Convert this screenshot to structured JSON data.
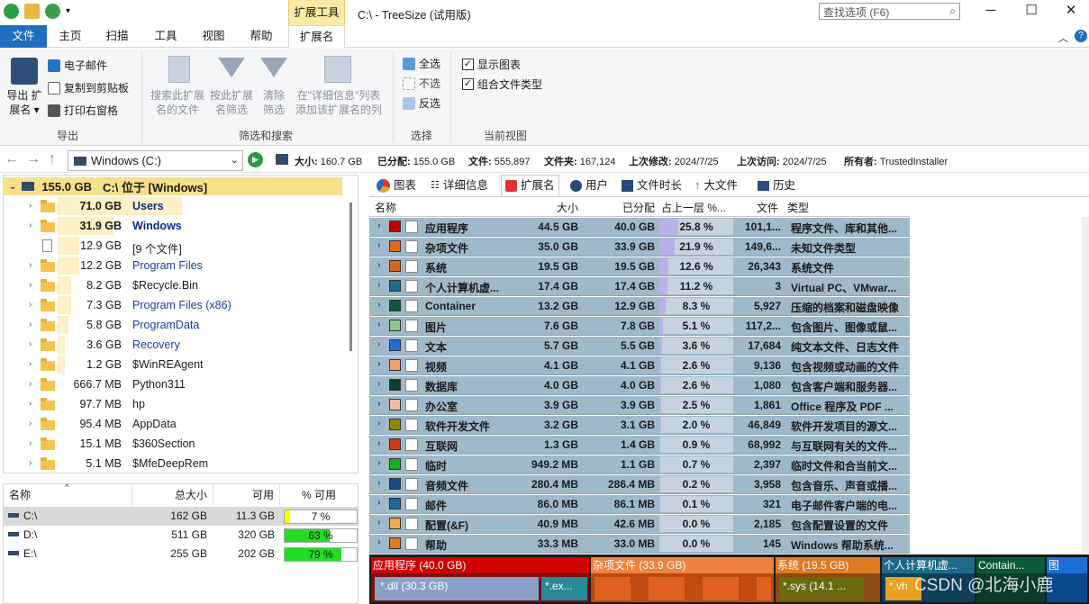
{
  "window": {
    "context_tab_title": "扩展工具",
    "title": "C:\\ - TreeSize  (试用版)",
    "search_placeholder": "查找选项 (F6)"
  },
  "ribbon_tabs": [
    "文件",
    "主页",
    "扫描",
    "工具",
    "视图",
    "帮助",
    "扩展名"
  ],
  "ribbon": {
    "export": {
      "big_label": "导出 扩\n展名 ▾",
      "items": [
        "电子邮件",
        "复制到剪贴板",
        "打印右窗格"
      ],
      "group": "导出"
    },
    "filter": {
      "buttons": [
        "搜索此扩展\n名的文件",
        "按此扩展\n名筛选",
        "清除\n筛选",
        "在\"详细信息\"列表\n添加该扩展名的列"
      ],
      "group": "筛选和搜索"
    },
    "select": {
      "items": [
        "全选",
        "不选",
        "反选"
      ],
      "group": "选择"
    },
    "view": {
      "items": [
        {
          "label": "显示图表",
          "checked": true
        },
        {
          "label": "组合文件类型",
          "checked": true
        }
      ],
      "group": "当前视图"
    }
  },
  "address": {
    "drive": "Windows (C:)",
    "stats": [
      {
        "label": "大小:",
        "value": "160.7 GB"
      },
      {
        "label": "已分配:",
        "value": "155.0 GB"
      },
      {
        "label": "文件:",
        "value": "555,897"
      },
      {
        "label": "文件夹:",
        "value": "167,124"
      },
      {
        "label": "上次修改:",
        "value": "2024/7/25"
      },
      {
        "label": "上次访问:",
        "value": "2024/7/25"
      },
      {
        "label": "所有者:",
        "value": "TrustedInstaller"
      }
    ]
  },
  "tree": {
    "root": {
      "size": "155.0 GB",
      "label": "C:\\  位于  [Windows]"
    },
    "rows": [
      {
        "size": "71.0 GB",
        "name": "Users",
        "bold": true,
        "fraction": 0.46,
        "icon": "folder"
      },
      {
        "size": "31.9 GB",
        "name": "Windows",
        "bold": true,
        "fraction": 0.21,
        "icon": "folder"
      },
      {
        "size": "12.9 GB",
        "name": "[9 个文件]",
        "bold": false,
        "fraction": 0.08,
        "icon": "file"
      },
      {
        "size": "12.2 GB",
        "name": "Program Files",
        "bold": false,
        "fraction": 0.08,
        "icon": "folder",
        "blue": true
      },
      {
        "size": "8.2 GB",
        "name": "$Recycle.Bin",
        "bold": false,
        "fraction": 0.05,
        "icon": "folder"
      },
      {
        "size": "7.3 GB",
        "name": "Program Files (x86)",
        "bold": false,
        "fraction": 0.05,
        "icon": "folder",
        "blue": true
      },
      {
        "size": "5.8 GB",
        "name": "ProgramData",
        "bold": false,
        "fraction": 0.04,
        "icon": "folder",
        "blue": true
      },
      {
        "size": "3.6 GB",
        "name": "Recovery",
        "bold": false,
        "fraction": 0.02,
        "icon": "folder",
        "blue": true
      },
      {
        "size": "1.2 GB",
        "name": "$WinREAgent",
        "bold": false,
        "fraction": 0.01,
        "icon": "folder"
      },
      {
        "size": "666.7 MB",
        "name": "Python311",
        "bold": false,
        "fraction": 0,
        "icon": "folder"
      },
      {
        "size": "97.7 MB",
        "name": "hp",
        "bold": false,
        "fraction": 0,
        "icon": "folder"
      },
      {
        "size": "95.4 MB",
        "name": "AppData",
        "bold": false,
        "fraction": 0,
        "icon": "folder"
      },
      {
        "size": "15.1 MB",
        "name": "$360Section",
        "bold": false,
        "fraction": 0,
        "icon": "folder"
      },
      {
        "size": "5.1 MB",
        "name": "$MfeDeepRem",
        "bold": false,
        "fraction": 0,
        "icon": "folder"
      }
    ]
  },
  "drives": {
    "headers": [
      "名称",
      "总大小",
      "可用",
      "% 可用"
    ],
    "rows": [
      {
        "name": "C:\\",
        "total": "162 GB",
        "free": "11.3 GB",
        "pct": "7 %",
        "fraction": 0.07,
        "color": "#ffff00"
      },
      {
        "name": "D:\\",
        "total": "511 GB",
        "free": "320 GB",
        "pct": "63 %",
        "fraction": 0.63,
        "color": "#22dd22"
      },
      {
        "name": "E:\\",
        "total": "255 GB",
        "free": "202 GB",
        "pct": "79 %",
        "fraction": 0.79,
        "color": "#22dd22"
      }
    ]
  },
  "view_tabs": [
    "图表",
    "详细信息",
    "扩展名",
    "用户",
    "文件时长",
    "大文件",
    "历史"
  ],
  "grid": {
    "headers": [
      "名称",
      "大小",
      "已分配",
      "占上一层 %...",
      "文件",
      "类型"
    ],
    "rows": [
      {
        "name": "应用程序",
        "size": "44.5 GB",
        "alloc": "40.0 GB",
        "pct": "25.8 %",
        "frac": 0.258,
        "files": "101,1...",
        "type": "程序文件、库和其他...",
        "color": "#c00000"
      },
      {
        "name": "杂项文件",
        "size": "35.0 GB",
        "alloc": "33.9 GB",
        "pct": "21.9 %",
        "frac": 0.219,
        "files": "149,6...",
        "type": "未知文件类型",
        "color": "#e06a1a"
      },
      {
        "name": "系统",
        "size": "19.5 GB",
        "alloc": "19.5 GB",
        "pct": "12.6 %",
        "frac": 0.126,
        "files": "26,343",
        "type": "系统文件",
        "color": "#d8661c"
      },
      {
        "name": "个人计算机虚...",
        "size": "17.4 GB",
        "alloc": "17.4 GB",
        "pct": "11.2 %",
        "frac": 0.112,
        "files": "3",
        "type": "Virtual PC、VMwar...",
        "color": "#1f6a8a"
      },
      {
        "name": "Container",
        "size": "13.2 GB",
        "alloc": "12.9 GB",
        "pct": "8.3 %",
        "frac": 0.083,
        "files": "5,927",
        "type": "压缩的档案和磁盘映像",
        "color": "#0a5a3a"
      },
      {
        "name": "图片",
        "size": "7.6 GB",
        "alloc": "7.8 GB",
        "pct": "5.1 %",
        "frac": 0.051,
        "files": "117,2...",
        "type": "包含图片、图像或鼠...",
        "color": "#8fc88f"
      },
      {
        "name": "文本",
        "size": "5.7 GB",
        "alloc": "5.5 GB",
        "pct": "3.6 %",
        "frac": 0.036,
        "files": "17,684",
        "type": "纯文本文件、日志文件",
        "color": "#1e6ed6"
      },
      {
        "name": "视频",
        "size": "4.1 GB",
        "alloc": "4.1 GB",
        "pct": "2.6 %",
        "frac": 0.026,
        "files": "9,136",
        "type": "包含视频或动画的文件",
        "color": "#f0a070"
      },
      {
        "name": "数据库",
        "size": "4.0 GB",
        "alloc": "4.0 GB",
        "pct": "2.6 %",
        "frac": 0.026,
        "files": "1,080",
        "type": "包含客户端和服务器...",
        "color": "#0e3e2a"
      },
      {
        "name": "办公室",
        "size": "3.9 GB",
        "alloc": "3.9 GB",
        "pct": "2.5 %",
        "frac": 0.025,
        "files": "1,861",
        "type": "Office 程序及 PDF ...",
        "color": "#f2b8a8"
      },
      {
        "name": "软件开发文件",
        "size": "3.2 GB",
        "alloc": "3.1 GB",
        "pct": "2.0 %",
        "frac": 0.02,
        "files": "46,849",
        "type": "软件开发项目的源文...",
        "color": "#8a8a00"
      },
      {
        "name": "互联网",
        "size": "1.3 GB",
        "alloc": "1.4 GB",
        "pct": "0.9 %",
        "frac": 0.009,
        "files": "68,992",
        "type": "与互联网有关的文件...",
        "color": "#d03a10"
      },
      {
        "name": "临时",
        "size": "949.2 MB",
        "alloc": "1.1 GB",
        "pct": "0.7 %",
        "frac": 0.007,
        "files": "2,397",
        "type": "临时文件和合当前文...",
        "color": "#1aaa1a"
      },
      {
        "name": "音频文件",
        "size": "280.4 MB",
        "alloc": "286.4 MB",
        "pct": "0.2 %",
        "frac": 0.002,
        "files": "3,958",
        "type": "包含音乐、声音或播...",
        "color": "#1a4a7a"
      },
      {
        "name": "邮件",
        "size": "86.0 MB",
        "alloc": "86.1 MB",
        "pct": "0.1 %",
        "frac": 0.001,
        "files": "321",
        "type": "电子邮件客户端的电...",
        "color": "#1a6a9a"
      },
      {
        "name": "配置(&F)",
        "size": "40.9 MB",
        "alloc": "42.6 MB",
        "pct": "0.0 %",
        "frac": 0,
        "files": "2,185",
        "type": "包含配置设置的文件",
        "color": "#f0a850"
      },
      {
        "name": "帮助",
        "size": "33.3 MB",
        "alloc": "33.0 MB",
        "pct": "0.0 %",
        "frac": 0,
        "files": "145",
        "type": "Windows 帮助系统...",
        "color": "#e07a20"
      }
    ]
  },
  "treemap": [
    {
      "label": "应用程序 (40.0 GB)",
      "sub": "*.dll (30.3 GB)",
      "sub2": "*.ex...",
      "color": "#c00000"
    },
    {
      "label": "杂项文件 (33.9 GB)",
      "color": "#e06a1a"
    },
    {
      "label": "系统 (19.5 GB)",
      "sub": "*.sys (14.1 ...",
      "color": "#d8661c"
    },
    {
      "label": "个人计算机虚...",
      "sub": "*.vh",
      "color": "#1f6a8a"
    },
    {
      "label": "Contain...",
      "color": "#0a5a3a"
    },
    {
      "label": "图",
      "color": "#1e6ed6"
    }
  ],
  "watermark": "CSDN @北海小鹿"
}
